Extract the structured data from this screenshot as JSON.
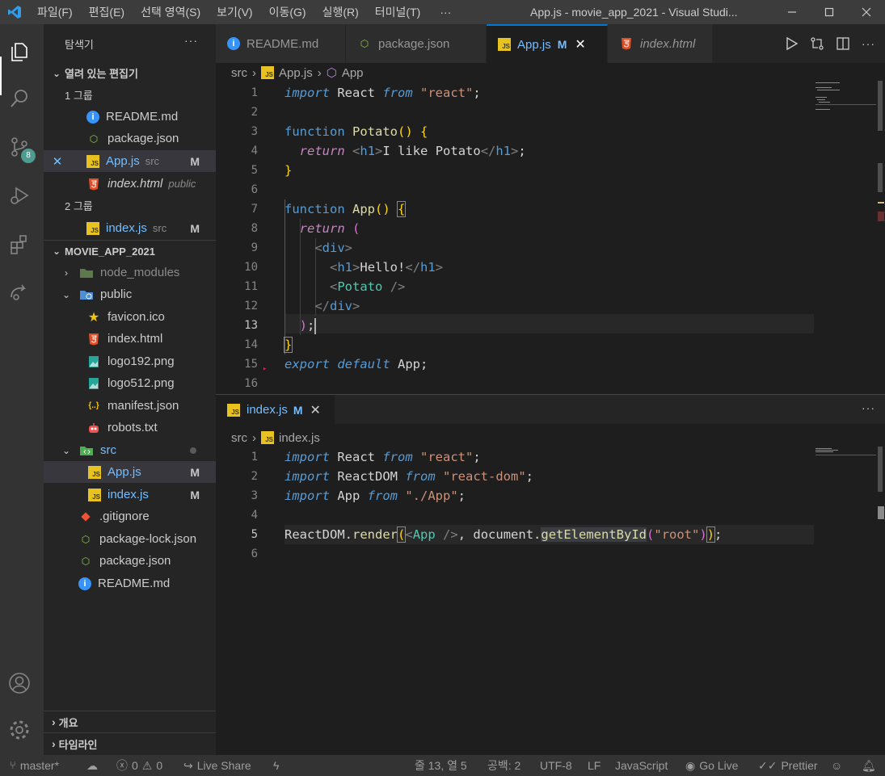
{
  "titlebar": {
    "menus": [
      "파일(F)",
      "편집(E)",
      "선택 영역(S)",
      "보기(V)",
      "이동(G)",
      "실행(R)",
      "터미널(T)"
    ],
    "more": "···",
    "title": "App.js - movie_app_2021 - Visual Studi..."
  },
  "activity": {
    "scm_badge": "8"
  },
  "sidebar": {
    "title": "탐색기",
    "more": "···",
    "open_editors": "열려 있는 편집기",
    "group1": "1 그룹",
    "group2": "2 그룹",
    "open_files": [
      {
        "name": "README.md"
      },
      {
        "name": "package.json"
      },
      {
        "name": "App.js",
        "hint": "src",
        "status": "M"
      },
      {
        "name": "index.html",
        "hint": "public"
      },
      {
        "name": "index.js",
        "hint": "src",
        "status": "M"
      }
    ],
    "project": "MOVIE_APP_2021",
    "tree": [
      {
        "name": "node_modules"
      },
      {
        "name": "public"
      },
      {
        "name": "favicon.ico"
      },
      {
        "name": "index.html"
      },
      {
        "name": "logo192.png"
      },
      {
        "name": "logo512.png"
      },
      {
        "name": "manifest.json"
      },
      {
        "name": "robots.txt"
      },
      {
        "name": "src"
      },
      {
        "name": "App.js",
        "status": "M"
      },
      {
        "name": "index.js",
        "status": "M"
      },
      {
        "name": ".gitignore"
      },
      {
        "name": "package-lock.json"
      },
      {
        "name": "package.json"
      },
      {
        "name": "README.md"
      }
    ],
    "outline": "개요",
    "timeline": "타임라인"
  },
  "editor1": {
    "tabs": [
      {
        "label": "README.md"
      },
      {
        "label": "package.json"
      },
      {
        "label": "App.js",
        "status": "M"
      },
      {
        "label": "index.html"
      }
    ],
    "breadcrumb": [
      "src",
      "App.js",
      "App"
    ],
    "line_numbers": [
      "1",
      "2",
      "3",
      "4",
      "5",
      "6",
      "7",
      "8",
      "9",
      "10",
      "11",
      "12",
      "13",
      "14",
      "15",
      "16"
    ],
    "current_line": "13"
  },
  "editor2": {
    "tab": {
      "label": "index.js",
      "status": "M"
    },
    "more": "···",
    "breadcrumb": [
      "src",
      "index.js"
    ],
    "line_numbers": [
      "1",
      "2",
      "3",
      "4",
      "5",
      "6"
    ],
    "current_line": "5"
  },
  "statusbar": {
    "branch": "master*",
    "errors": "0",
    "warnings": "0",
    "live_share": "Live Share",
    "position": "줄 13, 열 5",
    "spaces": "공백: 2",
    "encoding": "UTF-8",
    "eol": "LF",
    "language": "JavaScript",
    "go_live": "Go Live",
    "prettier": "Prettier"
  },
  "colors": {
    "accent": "#0078d4",
    "modified": "#75beff",
    "js_icon": "#e8c21f",
    "html_icon": "#e44d26",
    "scm_badge": "#4d9c8f"
  }
}
